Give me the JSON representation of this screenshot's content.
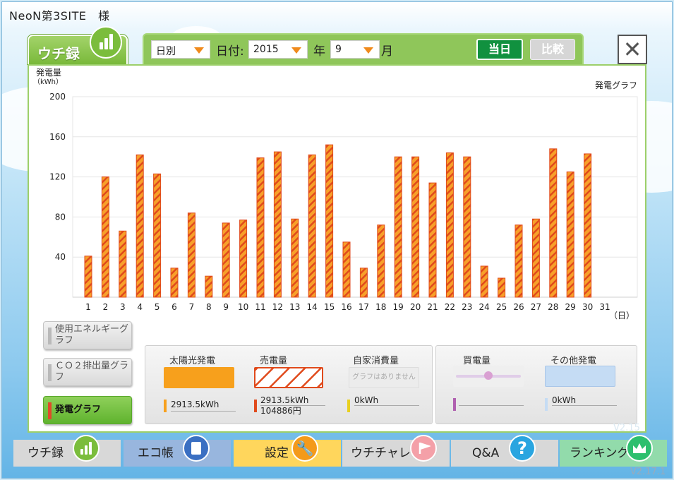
{
  "site_title": "NeoN第3SITE　様",
  "tab": {
    "label": "ウチ録"
  },
  "controls": {
    "mode": "日別",
    "date_label": "日付:",
    "year": "2015",
    "year_unit": "年",
    "month": "9",
    "month_unit": "月",
    "today_label": "当日",
    "compare_label": "比較"
  },
  "close_label": "✕",
  "chart_data": {
    "type": "bar",
    "title": "発電グラフ",
    "ylabel": "発電量",
    "yunit": "（kWh）",
    "xunit": "（日）",
    "ylim": [
      0,
      200
    ],
    "yticks": [
      40,
      80,
      120,
      160,
      200
    ],
    "categories": [
      "1",
      "2",
      "3",
      "4",
      "5",
      "6",
      "7",
      "8",
      "9",
      "10",
      "11",
      "12",
      "13",
      "14",
      "15",
      "16",
      "17",
      "18",
      "19",
      "20",
      "21",
      "22",
      "23",
      "24",
      "25",
      "26",
      "27",
      "28",
      "29",
      "30",
      "31"
    ],
    "values": [
      41,
      120,
      66,
      142,
      123,
      29,
      84,
      21,
      74,
      77,
      139,
      145,
      78,
      142,
      152,
      55,
      29,
      72,
      140,
      140,
      114,
      144,
      140,
      31,
      19,
      72,
      78,
      148,
      125,
      143,
      null
    ],
    "colors": {
      "fill": "#f7a02a",
      "stripe": "#e04a1c"
    }
  },
  "side_buttons": [
    {
      "label": "使用エネルギーグラフ",
      "active": false
    },
    {
      "label": "ＣＯ２排出量グラフ",
      "active": false
    },
    {
      "label": "発電グラフ",
      "active": true
    }
  ],
  "legend": {
    "solar": {
      "title": "太陽光発電",
      "value": "2913.5kWh",
      "color": "#f7a01c"
    },
    "sold": {
      "title": "売電量",
      "value": "2913.5kWh",
      "value2": "104886円",
      "color": "#e04a1c"
    },
    "self": {
      "title": "自家消費量",
      "note": "グラフはありません",
      "value": "0kWh",
      "color": "#e8d020"
    },
    "buy": {
      "title": "買電量",
      "color": "#b060b0"
    },
    "other": {
      "title": "その他発電",
      "value": "0kWh",
      "color": "#c5dcf4"
    }
  },
  "nav": [
    {
      "label": "ウチ録",
      "color": "#d6d6d6",
      "icon_color": "#7bbd3c"
    },
    {
      "label": "エコ帳",
      "color": "#96b4dc",
      "icon_color": "#3a6fc2"
    },
    {
      "label": "設定",
      "color": "#ffd45a",
      "icon_color": "#f49a1a"
    },
    {
      "label": "ウチチャレ",
      "color": "#d6d6d6",
      "icon_color": "#f07f8a"
    },
    {
      "label": "Q&A",
      "color": "#d6d6d6",
      "icon_color": "#2aa5e0"
    },
    {
      "label": "ランキング",
      "color": "#8fd8a8",
      "icon_color": "#2dbf6e"
    }
  ],
  "version_inner": "V2.15",
  "version": "V2.17.1"
}
